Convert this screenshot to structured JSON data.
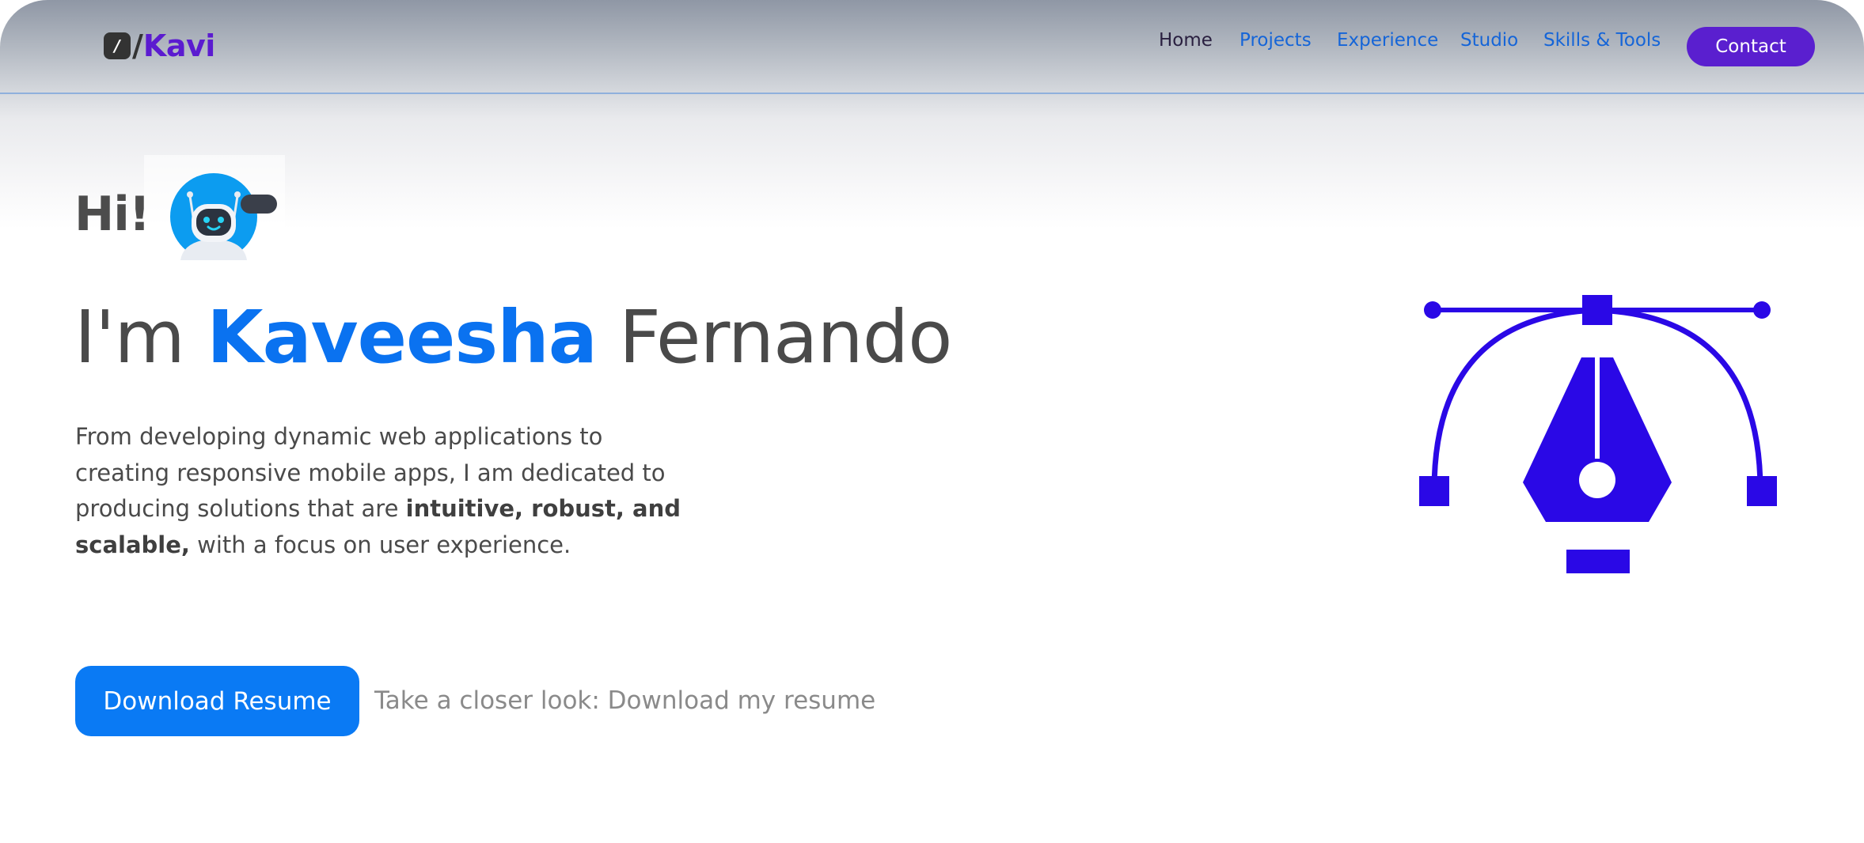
{
  "brand": {
    "badge": "/",
    "slash": "/",
    "name": "Kavi"
  },
  "nav": {
    "items": [
      "Home",
      "Projects",
      "Experience",
      "Studio",
      "Skills & Tools"
    ],
    "contact": "Contact"
  },
  "hero": {
    "greeting": "Hi!",
    "intro_prefix": "I'm",
    "first_name": "Kaveesha",
    "last_name": "Fernando",
    "desc_part1": "From developing dynamic web applications to creating responsive mobile apps, I am dedicated to producing solutions that are",
    "desc_bold": "intuitive, robust, and scalable,",
    "desc_part2": "with a focus on user experience.",
    "resume_button": "Download Resume",
    "resume_hint": "Take a closer look: Download my resume"
  },
  "colors": {
    "accent_blue": "#0a72f0",
    "brand_purple": "#5b1bd0",
    "contact_purple": "#5a1fcf",
    "pen_icon": "#2a08e6",
    "nav_link": "#1565d8"
  },
  "icons": {
    "robot": "robot-avatar-icon",
    "pen": "pen-tool-icon"
  }
}
